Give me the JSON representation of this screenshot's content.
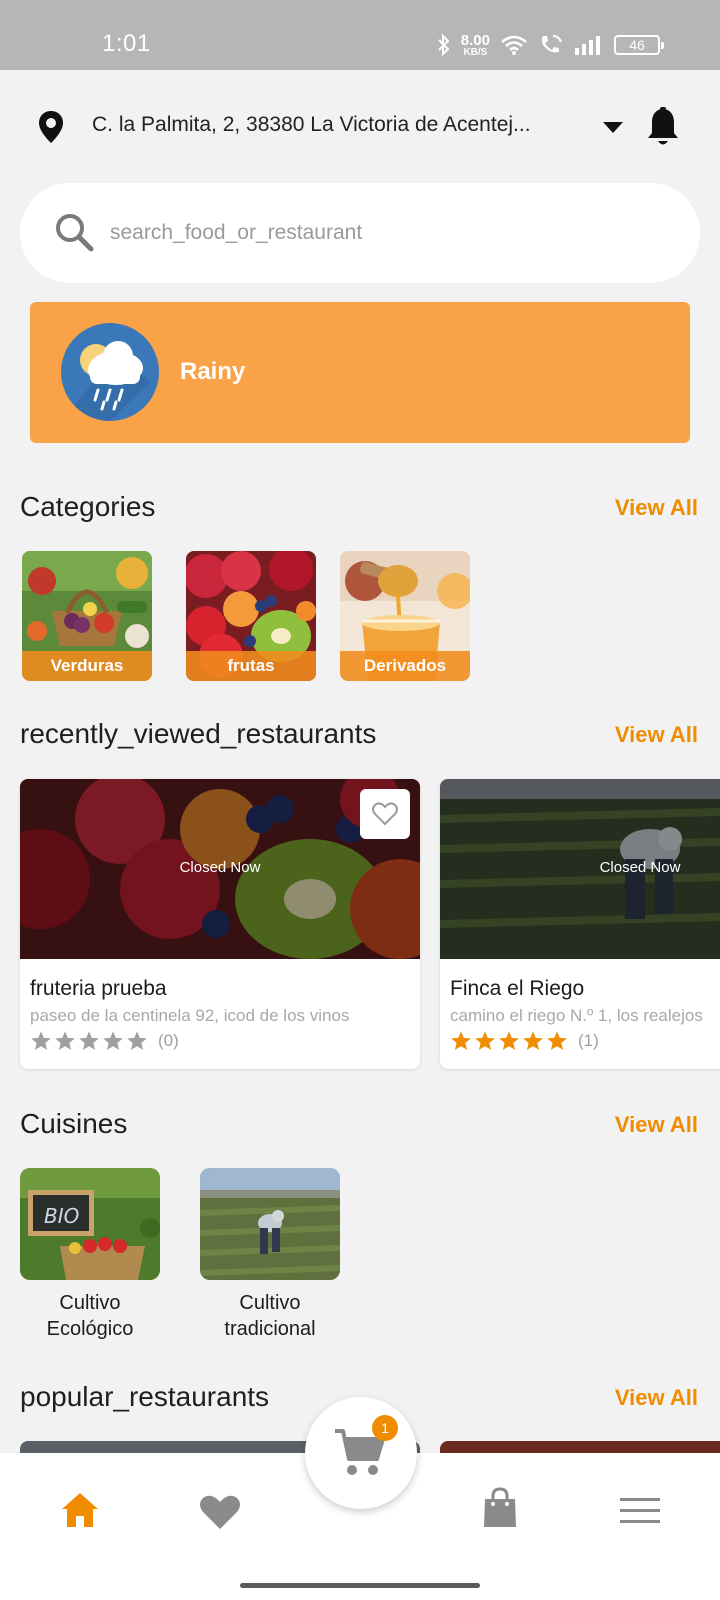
{
  "status_bar": {
    "time": "1:01",
    "net_speed_value": "8.00",
    "net_speed_unit": "KB/S",
    "battery": "46"
  },
  "header": {
    "address": "C. la Palmita, 2, 38380 La Victoria de Acentej...",
    "location_icon": "location-pin-icon",
    "dropdown_icon": "caret-down-icon",
    "notifications_icon": "bell-icon"
  },
  "search": {
    "placeholder": "search_food_or_restaurant"
  },
  "weather": {
    "label": "Rainy",
    "icon": "rain-cloud-icon"
  },
  "categories": {
    "title": "Categories",
    "view_all": "View All",
    "items": [
      {
        "label": "Verduras"
      },
      {
        "label": "frutas"
      },
      {
        "label": "Derivados"
      }
    ]
  },
  "recently_viewed": {
    "title": "recently_viewed_restaurants",
    "view_all": "View All",
    "items": [
      {
        "status": "Closed Now",
        "name": "fruteria prueba",
        "address": "paseo de la centinela 92, icod de los vinos",
        "rating": 0,
        "rating_count": "(0)"
      },
      {
        "status": "Closed Now",
        "name": "Finca el Riego",
        "address": "camino el riego N.º 1, los realejos",
        "rating": 5,
        "rating_count": "(1)"
      }
    ]
  },
  "cuisines": {
    "title": "Cuisines",
    "view_all": "View All",
    "items": [
      {
        "label": "Cultivo Ecológico",
        "line1": "Cultivo",
        "line2": "Ecológico",
        "sign_text": "BIO"
      },
      {
        "label": "Cultivo tradicional",
        "line1": "Cultivo",
        "line2": "tradicional"
      }
    ]
  },
  "popular": {
    "title": "popular_restaurants",
    "view_all": "View All"
  },
  "bottom_nav": {
    "items": [
      "home-icon",
      "heart-icon",
      "cart-icon",
      "shopping-bag-icon",
      "menu-icon"
    ],
    "active": "home-icon",
    "cart_badge": "1"
  },
  "colors": {
    "accent": "#f08c00",
    "weather_card": "#f9a248",
    "background": "#f2f2f2",
    "star_active": "#f08c00",
    "star_inactive": "#a0a0a0"
  }
}
